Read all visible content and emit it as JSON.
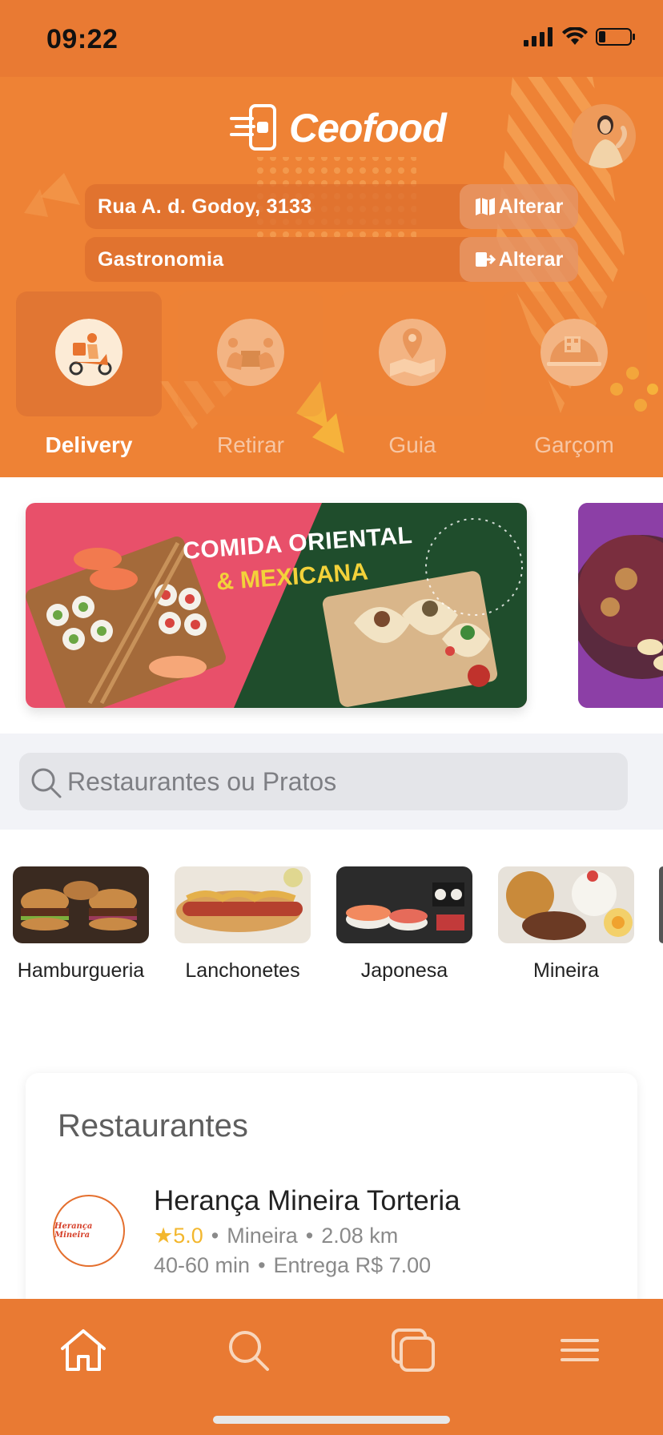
{
  "status_bar": {
    "time": "09:22"
  },
  "app": {
    "name": "Ceofood"
  },
  "location": {
    "address": "Rua A. d. Godoy, 3133",
    "address_change_label": "Alterar",
    "category": "Gastronomia",
    "category_change_label": "Alterar"
  },
  "modes": [
    {
      "label": "Delivery",
      "icon": "scooter-delivery-icon",
      "active": true
    },
    {
      "label": "Retirar",
      "icon": "pickup-box-icon",
      "active": false
    },
    {
      "label": "Guia",
      "icon": "map-pin-icon",
      "active": false
    },
    {
      "label": "Garçom",
      "icon": "cloche-icon",
      "active": false
    }
  ],
  "banners": [
    {
      "title": "COMIDA ORIENTAL",
      "subtitle": "& MEXICANA"
    }
  ],
  "search": {
    "placeholder": "Restaurantes ou Pratos"
  },
  "categories": [
    {
      "label": "Hamburgueria"
    },
    {
      "label": "Lanchonetes"
    },
    {
      "label": "Japonesa"
    },
    {
      "label": "Mineira"
    }
  ],
  "restaurants": {
    "title": "Restaurantes",
    "items": [
      {
        "name": "Herança Mineira Torteria",
        "logo_text": "Herança Mineira",
        "rating": "5.0",
        "cuisine": "Mineira",
        "distance": "2.08 km",
        "time": "40-60 min",
        "delivery": "Entrega R$ 7.00"
      }
    ]
  },
  "tabbar": {
    "items": [
      "home-icon",
      "search-icon",
      "orders-icon",
      "menu-icon"
    ]
  },
  "colors": {
    "primary": "#EE8235",
    "tabbar": "#E97A33",
    "rating": "#F3B72E"
  }
}
